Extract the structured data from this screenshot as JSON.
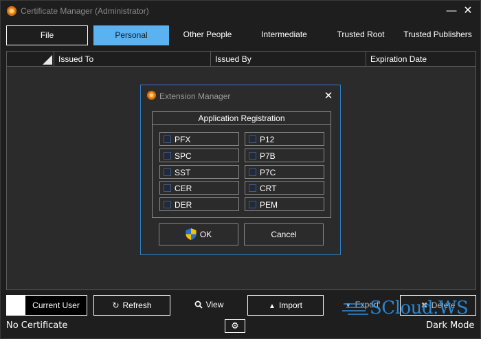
{
  "window": {
    "title": "Certificate Manager (Administrator)",
    "minimize_glyph": "—",
    "close_glyph": "✕"
  },
  "tabs": [
    {
      "label": "File",
      "active": false
    },
    {
      "label": "Personal",
      "active": true
    },
    {
      "label": "Other People",
      "active": false
    },
    {
      "label": "Intermediate",
      "active": false
    },
    {
      "label": "Trusted Root",
      "active": false
    },
    {
      "label": "Trusted Publishers",
      "active": false
    }
  ],
  "table": {
    "columns": [
      "Issued To",
      "Issued By",
      "Expiration Date"
    ],
    "rows": []
  },
  "dialog": {
    "title": "Extension Manager",
    "close_glyph": "✕",
    "group_title": "Application Registration",
    "extensions_left": [
      {
        "label": "PFX",
        "checked": false
      },
      {
        "label": "SPC",
        "checked": false
      },
      {
        "label": "SST",
        "checked": false
      },
      {
        "label": "CER",
        "checked": false
      },
      {
        "label": "DER",
        "checked": false
      }
    ],
    "extensions_right": [
      {
        "label": "P12",
        "checked": false
      },
      {
        "label": "P7B",
        "checked": false
      },
      {
        "label": "P7C",
        "checked": false
      },
      {
        "label": "CRT",
        "checked": false
      },
      {
        "label": "PEM",
        "checked": false
      }
    ],
    "ok_label": "OK",
    "cancel_label": "Cancel"
  },
  "toolbar": {
    "store_toggle_label": "Current User",
    "refresh_label": "Refresh",
    "view_label": "View",
    "import_label": "Import",
    "export_label": "Export",
    "delete_label": "Delete"
  },
  "status": {
    "left_text": "No Certificate",
    "right_text": "Dark Mode"
  },
  "icons": {
    "refresh": "↻",
    "view": "magnifier-icon",
    "import": "▲",
    "export": "▼",
    "delete": "✖",
    "settings": "⚙"
  },
  "watermark": {
    "text": "SCloud.WS"
  },
  "colors": {
    "accent": "#5ab2f0",
    "dialog_border": "#2f7fc8",
    "background": "#1e1e1e",
    "panel": "#2b2b2b",
    "app_icon": "#f7931e"
  }
}
